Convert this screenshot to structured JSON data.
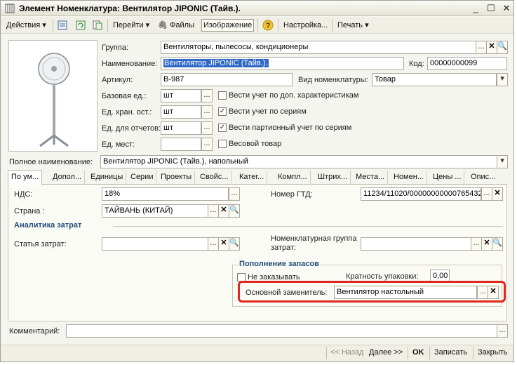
{
  "window": {
    "title": "Элемент Номенклатура: Вентилятор JIPONIC (Тайв.)."
  },
  "toolbar": {
    "actions": "Действия",
    "goto": "Перейти",
    "files": "Файлы",
    "image": "Изображение",
    "settings": "Настройка...",
    "print": "Печать"
  },
  "form": {
    "group_label": "Группа:",
    "group_value": "Вентиляторы, пылесосы, кондиционеры",
    "name_label": "Наименование:",
    "name_value": "Вентилятор JIPONIC (Тайв.).",
    "code_label": "Код:",
    "code_value": "00000000099",
    "article_label": "Артикул:",
    "article_value": "В-987",
    "kind_label": "Вид номенклатуры:",
    "kind_value": "Товар",
    "base_unit_label": "Базовая ед.:",
    "base_unit_value": "шт",
    "storage_unit_label": "Ед. хран. ост.:",
    "storage_unit_value": "шт",
    "report_unit_label": "Ед. для отчетов:",
    "report_unit_value": "шт",
    "places_unit_label": "Ед. мест:",
    "places_unit_value": "",
    "cb_extra_chars": "Вести учет по доп. характеристикам",
    "cb_series": "Вести учет по сериям",
    "cb_batch_series": "Вести партионный учет по сериям",
    "cb_weight": "Весовой товар",
    "full_name_label": "Полное наименование:",
    "full_name_value": "Вентилятор JIPONIC (Тайв.), напольный"
  },
  "tabs": [
    "По ум...",
    "Допол...",
    "Единицы",
    "Серии",
    "Проекты",
    "Свойс...",
    "Катег...",
    "Компл...",
    "Штрих...",
    "Места...",
    "Номен...",
    "Цены ...",
    "Опис..."
  ],
  "panel": {
    "vat_label": "НДС:",
    "vat_value": "18%",
    "gtd_label": "Номер ГТД:",
    "gtd_value": "11234/11020/00000000000765432",
    "country_label": "Страна :",
    "country_value": "ТАЙВАНЬ (КИТАЙ)",
    "cost_group_title": "Аналитика затрат",
    "cost_item_label": "Статья затрат:",
    "cost_item_value": "",
    "nom_group_label_1": "Номенклатурная группа",
    "nom_group_label_2": "затрат:",
    "nom_group_value": "",
    "replenish_title": "Пополнение запасов",
    "no_order_label": "Не заказывать",
    "pack_label": "Кратность упаковки:",
    "pack_value": "0,00",
    "replacement_label": "Основной заменитель:",
    "replacement_value": "Вентилятор настольный"
  },
  "comment": {
    "label": "Комментарий:",
    "value": ""
  },
  "bottom": {
    "back": "<< Назад",
    "next": "Далее >>",
    "ok": "OK",
    "save": "Записать",
    "close": "Закрыть"
  },
  "colors": {
    "highlight": "#e0271c",
    "selection": "#3169c6"
  }
}
